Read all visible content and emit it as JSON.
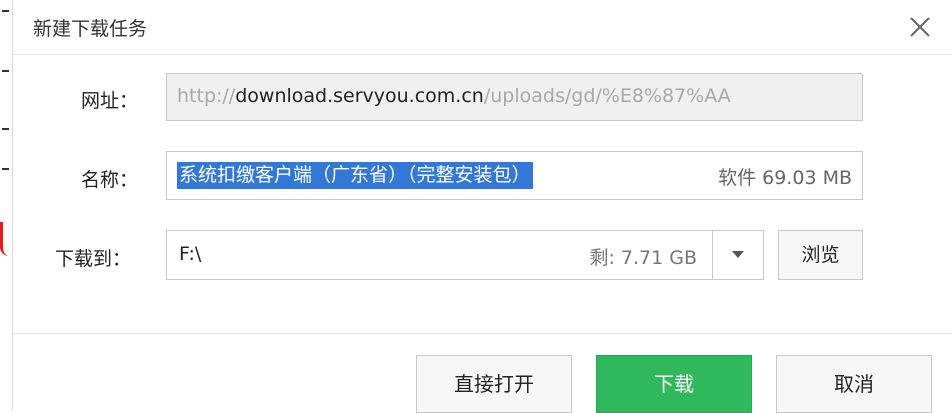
{
  "dialog": {
    "title": "新建下载任务",
    "close_icon": "close-icon"
  },
  "url": {
    "label": "网址：",
    "prefix": "http://",
    "domain": "download.servyou.com.cn",
    "rest": "/uploads/gd/%E8%87%AA"
  },
  "name": {
    "label": "名称：",
    "value": "系统扣缴客户端（广东省）（完整安装包）",
    "meta": "软件 69.03 MB"
  },
  "save_to": {
    "label": "下载到：",
    "path": "F:\\",
    "free_space": "剩: 7.71 GB",
    "dropdown_icon": "chevron-down-icon",
    "browse_label": "浏览"
  },
  "buttons": {
    "open_directly": "直接打开",
    "download": "下载",
    "cancel": "取消"
  },
  "colors": {
    "accent_green": "#30b85c",
    "selection_blue": "#3378d6"
  }
}
